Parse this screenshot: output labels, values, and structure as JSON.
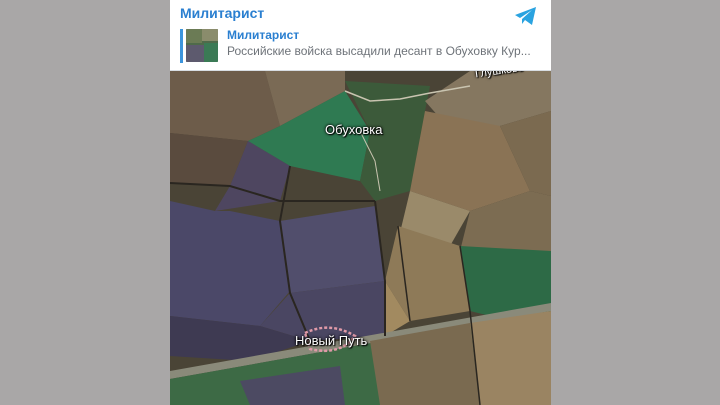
{
  "header": {
    "channel_title": "Милитарист",
    "reply": {
      "title": "Милитарист",
      "text": "Российские войска высадили десант в Обуховку Кур..."
    },
    "icon": "telegram-icon"
  },
  "map": {
    "labels": {
      "village_obukhovka": "Обуховка",
      "village_novyi_put": "Новый Путь",
      "road_glushkovo": "Глушково"
    }
  },
  "colors": {
    "link_blue": "#2a7fd0",
    "telegram_blue": "#2aa3e0",
    "page_background": "#a9a7a7"
  }
}
